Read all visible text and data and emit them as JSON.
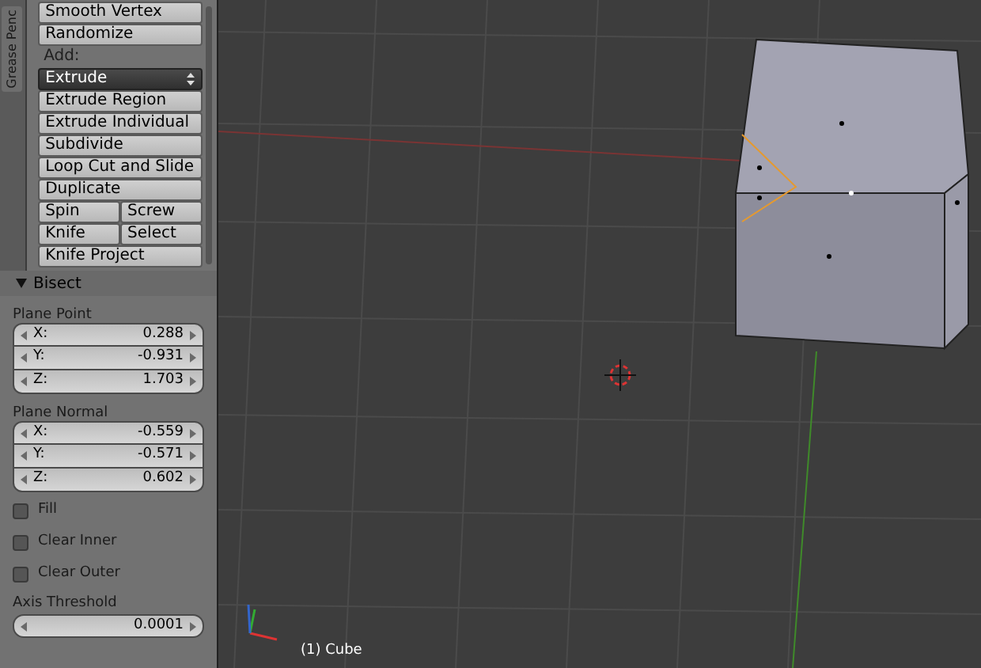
{
  "sidebar_tab": {
    "label": "Grease Penc"
  },
  "tools": [
    {
      "kind": "button",
      "label": "Smooth Vertex"
    },
    {
      "kind": "button",
      "label": "Randomize"
    },
    {
      "kind": "heading",
      "label": "Add:"
    },
    {
      "kind": "dropdown",
      "label": "Extrude"
    },
    {
      "kind": "button",
      "label": "Extrude Region"
    },
    {
      "kind": "button",
      "label": "Extrude Individual"
    },
    {
      "kind": "button",
      "label": "Subdivide"
    },
    {
      "kind": "button",
      "label": "Loop Cut and Slide"
    },
    {
      "kind": "button",
      "label": "Duplicate"
    },
    {
      "kind": "pair",
      "labels": [
        "Spin",
        "Screw"
      ]
    },
    {
      "kind": "pair",
      "labels": [
        "Knife",
        "Select"
      ]
    },
    {
      "kind": "button",
      "label": "Knife Project"
    }
  ],
  "operator": {
    "title": "Bisect",
    "expanded": true,
    "groups": [
      {
        "label": "Plane Point",
        "fields": [
          {
            "axis": "X:",
            "value": "0.288"
          },
          {
            "axis": "Y:",
            "value": "-0.931"
          },
          {
            "axis": "Z:",
            "value": "1.703"
          }
        ]
      },
      {
        "label": "Plane Normal",
        "fields": [
          {
            "axis": "X:",
            "value": "-0.559"
          },
          {
            "axis": "Y:",
            "value": "-0.571"
          },
          {
            "axis": "Z:",
            "value": "0.602"
          }
        ]
      }
    ],
    "checkboxes": [
      {
        "label": "Fill",
        "checked": false
      },
      {
        "label": "Clear Inner",
        "checked": false
      },
      {
        "label": "Clear Outer",
        "checked": false
      }
    ],
    "threshold": {
      "label": "Axis Threshold",
      "value": "0.0001"
    }
  },
  "viewport": {
    "object_label": "(1) Cube"
  }
}
